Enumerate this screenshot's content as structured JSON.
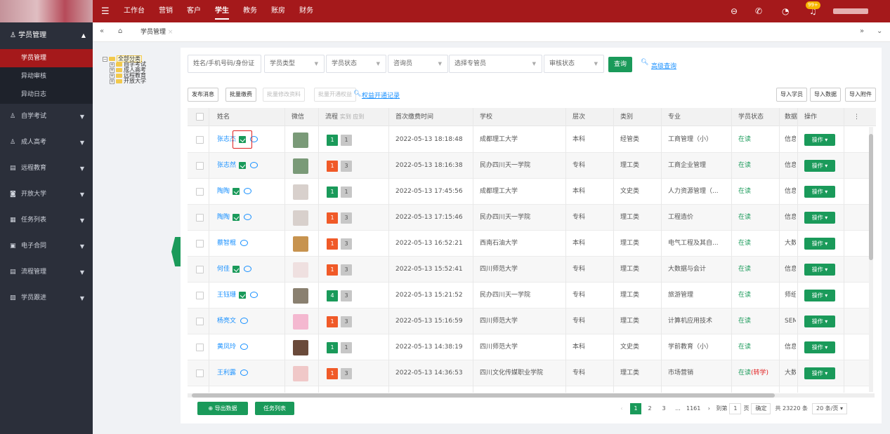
{
  "topnav": [
    "工作台",
    "营销",
    "客户",
    "学生",
    "教务",
    "账房",
    "财务"
  ],
  "badge": "99+",
  "sidebar": {
    "head": "学员管理",
    "subs": [
      "学员管理",
      "异动审核",
      "异动日志"
    ],
    "items": [
      "自学考试",
      "成人高考",
      "远程教育",
      "开放大学",
      "任务列表",
      "电子合同",
      "流程管理",
      "学员跟进"
    ]
  },
  "tab": "学员管理",
  "tree": [
    "全部分类",
    "自学考试",
    "成人高考",
    "远程教育",
    "开放大学"
  ],
  "filters": {
    "search": "姓名/手机号码/身份证",
    "type": "学员类型",
    "status": "学员状态",
    "consult": "咨询员",
    "mgr": "选择专管员",
    "audit": "审核状态",
    "query": "查询",
    "adv": "高级查询"
  },
  "actions": {
    "publish": "发布消息",
    "batch_pay": "批量缴费",
    "batch_edit": "批量修改资料",
    "batch_open": "批量开通权益",
    "rights": "权益开通记录",
    "import_student": "导入学员",
    "import_data": "导入数据",
    "import_att": "导入附件"
  },
  "headers": {
    "name": "姓名",
    "wechat": "微信",
    "flow": "流程",
    "flow_sub": "实到 应到",
    "time": "首次缴费时间",
    "school": "学校",
    "level": "层次",
    "cat": "类别",
    "major": "专业",
    "status": "学员状态",
    "data": "数据",
    "op": "操作",
    "more": "⋮"
  },
  "rows": [
    {
      "name": "张志杰",
      "edit": true,
      "f1": "1",
      "f1c": "g",
      "f2": "1",
      "time": "2022-05-13 18:18:48",
      "school": "成都理工大学",
      "level": "本科",
      "cat": "经管类",
      "major": "工商管理（小）",
      "status": "在读",
      "status_extra": "",
      "data": "信息",
      "thumb": "#7a9a78"
    },
    {
      "name": "张志然",
      "edit": true,
      "f1": "1",
      "f1c": "o",
      "f2": "3",
      "time": "2022-05-13 18:16:38",
      "school": "民办四川天一学院",
      "level": "专科",
      "cat": "理工类",
      "major": "工商企业管理",
      "status": "在读",
      "status_extra": "",
      "data": "信息",
      "thumb": "#7a9a78"
    },
    {
      "name": "陶陶",
      "edit": true,
      "f1": "1",
      "f1c": "g",
      "f2": "1",
      "time": "2022-05-13 17:45:56",
      "school": "成都理工大学",
      "level": "本科",
      "cat": "文史类",
      "major": "人力资源管理（...",
      "status": "在读",
      "status_extra": "",
      "data": "信息",
      "thumb": "#d8d0cc"
    },
    {
      "name": "陶陶",
      "edit": true,
      "f1": "1",
      "f1c": "o",
      "f2": "3",
      "time": "2022-05-13 17:15:46",
      "school": "民办四川天一学院",
      "level": "专科",
      "cat": "理工类",
      "major": "工程造价",
      "status": "在读",
      "status_extra": "",
      "data": "信息",
      "thumb": "#d8d0cc"
    },
    {
      "name": "蔡智棍",
      "edit": false,
      "f1": "1",
      "f1c": "o",
      "f2": "3",
      "time": "2022-05-13 16:52:21",
      "school": "西南石油大学",
      "level": "本科",
      "cat": "理工类",
      "major": "电气工程及其自...",
      "status": "在读",
      "status_extra": "",
      "data": "大数",
      "thumb": "#c7934f"
    },
    {
      "name": "何佳",
      "edit": true,
      "f1": "1",
      "f1c": "o",
      "f2": "3",
      "time": "2022-05-13 15:52:41",
      "school": "四川师范大学",
      "level": "专科",
      "cat": "理工类",
      "major": "大数据与会计",
      "status": "在读",
      "status_extra": "",
      "data": "信息",
      "thumb": "#efe0e0"
    },
    {
      "name": "王钰珊",
      "edit": true,
      "f1": "4",
      "f1c": "g",
      "f2": "3",
      "time": "2022-05-13 15:21:52",
      "school": "民办四川天一学院",
      "level": "专科",
      "cat": "理工类",
      "major": "旅游管理",
      "status": "在读",
      "status_extra": "",
      "data": "师组",
      "thumb": "#8a8070"
    },
    {
      "name": "杨亮文",
      "edit": false,
      "f1": "1",
      "f1c": "o",
      "f2": "3",
      "time": "2022-05-13 15:16:59",
      "school": "四川师范大学",
      "level": "专科",
      "cat": "理工类",
      "major": "计算机应用技术",
      "status": "在读",
      "status_extra": "",
      "data": "SEM",
      "thumb": "#f4b8d0"
    },
    {
      "name": "黄凤玲",
      "edit": false,
      "f1": "1",
      "f1c": "g",
      "f2": "1",
      "time": "2022-05-13 14:38:19",
      "school": "四川师范大学",
      "level": "本科",
      "cat": "文史类",
      "major": "学前教育（小）",
      "status": "在读",
      "status_extra": "",
      "data": "信息",
      "thumb": "#6a4a3a"
    },
    {
      "name": "王利露",
      "edit": false,
      "f1": "1",
      "f1c": "o",
      "f2": "3",
      "time": "2022-05-13 14:36:53",
      "school": "四川文化传媒职业学院",
      "level": "专科",
      "cat": "理工类",
      "major": "市场营销",
      "status": "在读",
      "status_extra": "(转学)",
      "data": "大数",
      "thumb": "#f0c8c8"
    }
  ],
  "op_label": "操作 ▾",
  "footer": {
    "export": "导出数据",
    "tasks": "任务列表",
    "pages": [
      "1",
      "2",
      "3",
      "...",
      "1161"
    ],
    "goto": "到第",
    "page_input": "1",
    "page_unit": "页",
    "confirm": "确定",
    "total": "共 23220 条",
    "per_page": "20 条/页"
  }
}
